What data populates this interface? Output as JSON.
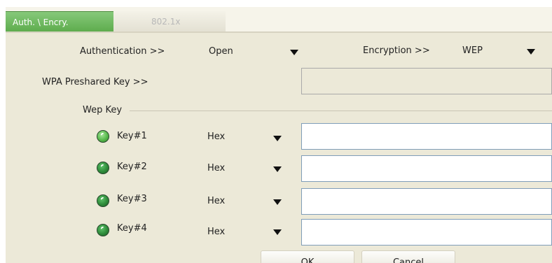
{
  "tabs": [
    {
      "label": "Auth. \\ Encry.",
      "active": true
    },
    {
      "label": "802.1x",
      "active": false
    }
  ],
  "authentication": {
    "label": "Authentication >>",
    "value": "Open"
  },
  "encryption": {
    "label": "Encryption >>",
    "value": "WEP"
  },
  "wpa": {
    "label": "WPA Preshared Key >>",
    "value": "",
    "enabled": false
  },
  "wep_group": {
    "label": "Wep Key"
  },
  "keys": [
    {
      "label": "Key#1",
      "format": "Hex",
      "value": "",
      "selected": true
    },
    {
      "label": "Key#2",
      "format": "Hex",
      "value": "",
      "selected": false
    },
    {
      "label": "Key#3",
      "format": "Hex",
      "value": "",
      "selected": false
    },
    {
      "label": "Key#4",
      "format": "Hex",
      "value": "",
      "selected": false
    }
  ],
  "buttons": {
    "ok": "OK",
    "cancel": "Cancel"
  },
  "colors": {
    "active_tab": "#5dab4c",
    "panel_bg": "#ece9d8",
    "field_border": "#7f9db9"
  }
}
